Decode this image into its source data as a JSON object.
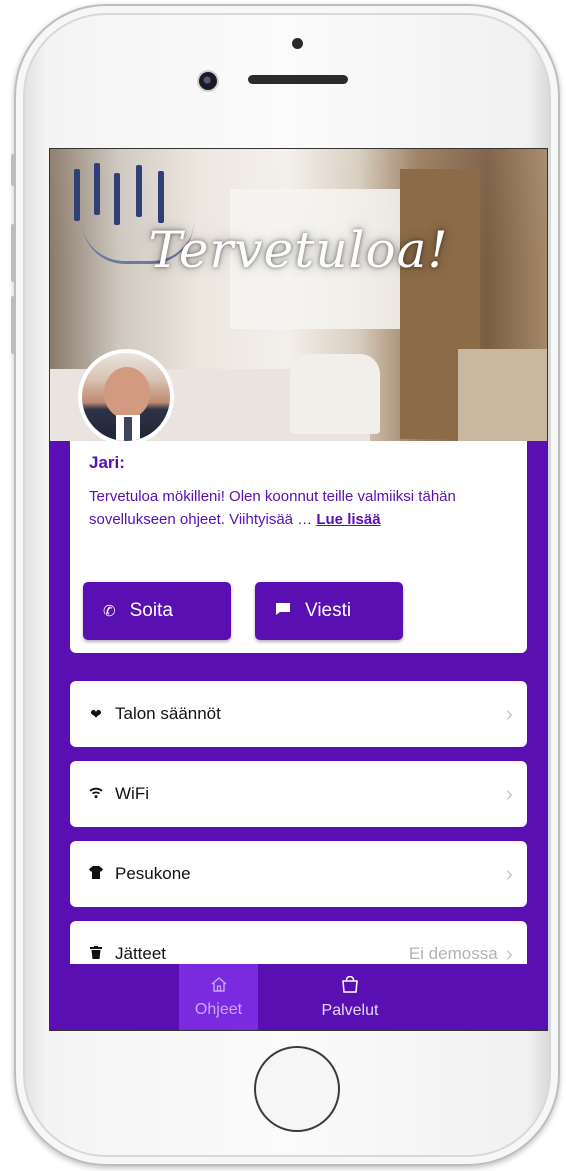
{
  "hero": {
    "greeting": "Tervetuloa!"
  },
  "host": {
    "name": "Jari:",
    "message": "Tervetuloa mökilleni! Olen koonnut teille valmiiksi tähän sovellukseen ohjeet. Viihtyisää … ",
    "read_more_label": "Lue lisää",
    "call_label": "Soita",
    "message_label": "Viesti"
  },
  "menu": {
    "items": [
      {
        "label": "Talon säännöt",
        "icon": "heart-icon",
        "note": ""
      },
      {
        "label": "WiFi",
        "icon": "wifi-icon",
        "note": ""
      },
      {
        "label": "Pesukone",
        "icon": "tshirt-icon",
        "note": ""
      },
      {
        "label": "Jätteet",
        "icon": "trash-icon",
        "note": "Ei demossa"
      }
    ]
  },
  "nav": {
    "tabs": [
      {
        "label": "Ohjeet",
        "icon": "home-icon",
        "active": true
      },
      {
        "label": "Palvelut",
        "icon": "shopping-bag-icon",
        "active": false
      }
    ]
  },
  "colors": {
    "primary": "#5a0fb3",
    "active_tab": "#7a2be0",
    "card": "#ffffff"
  }
}
